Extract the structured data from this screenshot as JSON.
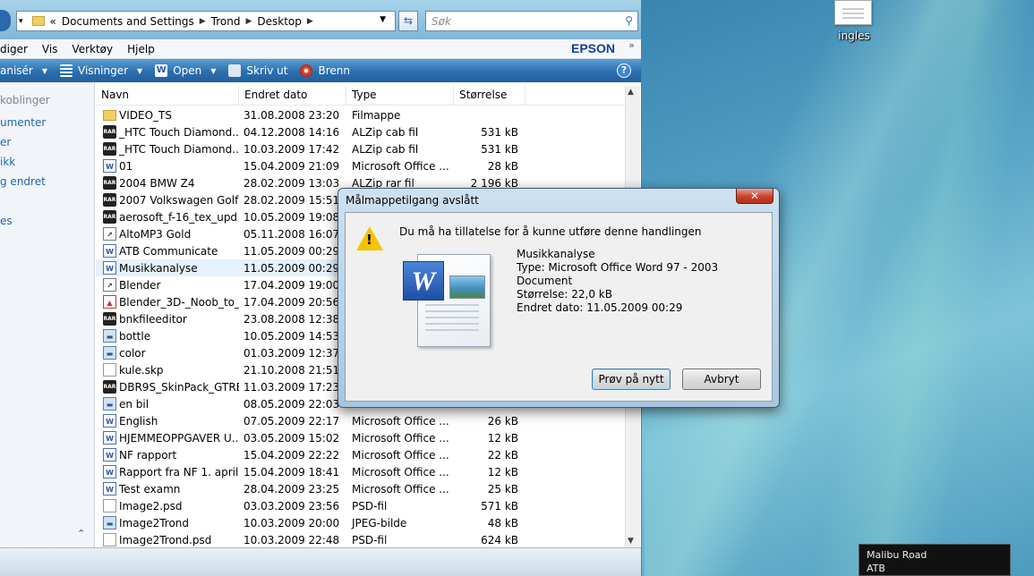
{
  "explorer": {
    "breadcrumb": {
      "prefix": "«",
      "parts": [
        "Documents and Settings",
        "Trond",
        "Desktop"
      ]
    },
    "search": {
      "placeholder": "Søk"
    },
    "menu": {
      "items": [
        "diger",
        "Vis",
        "Verktøy",
        "Hjelp"
      ],
      "brand": "EPSON"
    },
    "toolbar": {
      "organize": "anisér",
      "views": "Visninger",
      "open": "Open",
      "print": "Skriv ut",
      "burn": "Brenn"
    },
    "nav": {
      "title": "koblinger",
      "links": [
        "umenter",
        "er",
        "ikk",
        "g endret",
        "es"
      ]
    },
    "columns": {
      "name": "Navn",
      "date": "Endret dato",
      "type": "Type",
      "size": "Størrelse"
    },
    "files": [
      {
        "icon": "folder-icon",
        "name": "VIDEO_TS",
        "date": "31.08.2008 23:20",
        "type": "Filmappe",
        "size": ""
      },
      {
        "icon": "archive-icon",
        "name": "_HTC Touch Diamond...",
        "date": "04.12.2008 14:16",
        "type": "ALZip cab fil",
        "size": "531 kB"
      },
      {
        "icon": "archive-icon",
        "name": "_HTC Touch Diamond...",
        "date": "10.03.2009 17:42",
        "type": "ALZip cab fil",
        "size": "531 kB"
      },
      {
        "icon": "word-icon",
        "name": "01",
        "date": "15.04.2009 21:09",
        "type": "Microsoft Office ...",
        "size": "28 kB"
      },
      {
        "icon": "archive-icon",
        "name": "2004 BMW Z4",
        "date": "28.02.2009 13:03",
        "type": "ALZip rar fil",
        "size": "2 196 kB"
      },
      {
        "icon": "archive-icon",
        "name": "2007 Volkswagen Golf ...",
        "date": "28.02.2009 15:51",
        "type": "",
        "size": ""
      },
      {
        "icon": "archive-icon",
        "name": "aerosoft_f-16_tex_upd",
        "date": "10.05.2009 19:08",
        "type": "",
        "size": ""
      },
      {
        "icon": "shortcut-icon",
        "name": "AltoMP3 Gold",
        "date": "05.11.2008 16:07",
        "type": "",
        "size": ""
      },
      {
        "icon": "word-icon",
        "name": "ATB Communicate",
        "date": "11.05.2009 00:29",
        "type": "",
        "size": ""
      },
      {
        "icon": "word-icon",
        "name": "Musikkanalyse",
        "date": "11.05.2009 00:29",
        "type": "",
        "size": ""
      },
      {
        "icon": "shortcut-icon",
        "name": "Blender",
        "date": "17.04.2009 19:00",
        "type": "",
        "size": ""
      },
      {
        "icon": "pdf-icon",
        "name": "Blender_3D-_Noob_to_...",
        "date": "17.04.2009 20:56",
        "type": "",
        "size": ""
      },
      {
        "icon": "archive-icon",
        "name": "bnkfileeditor",
        "date": "23.08.2008 12:38",
        "type": "",
        "size": ""
      },
      {
        "icon": "image-icon",
        "name": "bottle",
        "date": "10.05.2009 14:53",
        "type": "",
        "size": ""
      },
      {
        "icon": "image-icon",
        "name": "color",
        "date": "01.03.2009 12:37",
        "type": "",
        "size": ""
      },
      {
        "icon": "blank-file-icon",
        "name": "kule.skp",
        "date": "21.10.2008 21:51",
        "type": "",
        "size": ""
      },
      {
        "icon": "archive-icon",
        "name": "DBR9S_SkinPack_GTRE...",
        "date": "11.03.2009 17:23",
        "type": "",
        "size": ""
      },
      {
        "icon": "image-icon",
        "name": "en bil",
        "date": "08.05.2009 22:03",
        "type": "",
        "size": ""
      },
      {
        "icon": "word-icon",
        "name": "English",
        "date": "07.05.2009 22:17",
        "type": "Microsoft Office ...",
        "size": "26 kB"
      },
      {
        "icon": "word-icon",
        "name": "HJEMMEOPPGAVER U...",
        "date": "03.05.2009 15:02",
        "type": "Microsoft Office ...",
        "size": "12 kB"
      },
      {
        "icon": "word-icon",
        "name": "NF rapport",
        "date": "15.04.2009 22:22",
        "type": "Microsoft Office ...",
        "size": "22 kB"
      },
      {
        "icon": "word-icon",
        "name": "Rapport fra NF 1. april! ...",
        "date": "15.04.2009 18:41",
        "type": "Microsoft Office ...",
        "size": "12 kB"
      },
      {
        "icon": "word-icon",
        "name": "Test examn",
        "date": "28.04.2009 23:25",
        "type": "Microsoft Office ...",
        "size": "25 kB"
      },
      {
        "icon": "blank-file-icon",
        "name": "Image2.psd",
        "date": "03.03.2009 23:56",
        "type": "PSD-fil",
        "size": "571 kB"
      },
      {
        "icon": "image-icon",
        "name": "Image2Trond",
        "date": "10.03.2009 20:00",
        "type": "JPEG-bilde",
        "size": "48 kB"
      },
      {
        "icon": "blank-file-icon",
        "name": "Image2Trond.psd",
        "date": "10.03.2009 22:48",
        "type": "PSD-fil",
        "size": "624 kB"
      }
    ],
    "selected_index": 9
  },
  "desktop": {
    "icon_label": "ingles",
    "tooltip": {
      "line1": "Malibu Road",
      "line2": "ATB"
    }
  },
  "dialog": {
    "title": "Målmappetilgang avslått",
    "close": "✕",
    "message": "Du må ha tillatelse for å kunne utføre denne handlingen",
    "file": {
      "name": "Musikkanalyse",
      "type": "Type: Microsoft Office Word 97 - 2003 Document",
      "size": "Størrelse: 22,0 kB",
      "modified": "Endret dato: 11.05.2009 00:29"
    },
    "retry": "Prøv på nytt",
    "cancel": "Avbryt"
  }
}
